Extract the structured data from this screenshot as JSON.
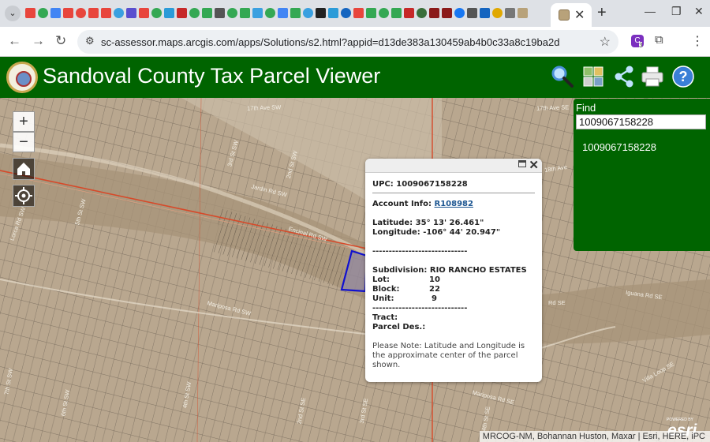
{
  "browser": {
    "url": "sc-assessor.maps.arcgis.com/apps/Solutions/s2.html?appid=d13de383a130459ab4b0c33a8c19ba2d",
    "extension_count": "3",
    "tab_icon_colors": [
      "#e8453c",
      "#34a853",
      "#4285f4",
      "#e8453c",
      "#e8453c",
      "#e8453c",
      "#e8453c",
      "#3aa0e0",
      "#5a4fcf",
      "#e8453c",
      "#34a853",
      "#2b9bd8",
      "#c62828",
      "#34a853",
      "#34a853",
      "#555555",
      "#34a853",
      "#34a853",
      "#3aa0e0",
      "#34a853",
      "#4285f4",
      "#34a853",
      "#3aa0e0",
      "#222222",
      "#2b9bd8",
      "#1565c0",
      "#e8453c",
      "#34a853",
      "#34a853",
      "#34a853",
      "#c62828",
      "#3a6e3a",
      "#8b1a1a",
      "#8b1a1a",
      "#1877f2",
      "#555555",
      "#1565c0",
      "#e0a800",
      "#777777",
      "#b8a27a"
    ]
  },
  "app": {
    "title": "Sandoval County Tax Parcel Viewer",
    "header_icons": [
      "search-icon",
      "basemap-gallery-icon",
      "share-icon",
      "print-icon",
      "help-icon"
    ]
  },
  "map": {
    "zoom_in": "+",
    "zoom_out": "−",
    "attribution": "MRCOG-NM, Bohannan Huston, Maxar | Esri, HERE, iPC",
    "powered_by": "POWERED BY",
    "esri": "esri",
    "streets": [
      {
        "name": "17th Ave SW"
      },
      {
        "name": "17th Ave SE"
      },
      {
        "name": "18th Ave"
      },
      {
        "name": "Jardin Rd SW"
      },
      {
        "name": "Encinal Rd SW"
      },
      {
        "name": "Mariposa Rd SW"
      },
      {
        "name": "Iguana Rd SE"
      },
      {
        "name": "Rd SE"
      },
      {
        "name": "Villa Loop SE"
      },
      {
        "name": "Mariposa Rd SE"
      },
      {
        "name": "3rd St SW"
      },
      {
        "name": "2nd St SW"
      },
      {
        "name": "5th St SW"
      },
      {
        "name": "7th St SW"
      },
      {
        "name": "6th St SW"
      },
      {
        "name": "4th St SW"
      },
      {
        "name": "Lorca Rd SW"
      },
      {
        "name": "2nd St SE"
      },
      {
        "name": "3rd St SE"
      },
      {
        "name": "4th St SE"
      }
    ]
  },
  "popup": {
    "upc_label": "UPC:",
    "upc": "1009067158228",
    "account_label": "Account Info:",
    "account": "R108982",
    "latitude_label": "Latitude:",
    "latitude": "35° 13' 26.461\"",
    "longitude_label": "Longitude:",
    "longitude": "-106° 44' 20.947\"",
    "divider": "-----------------------------",
    "subdivision_label": "Subdivision:",
    "subdivision": "RIO RANCHO ESTATES",
    "lot_label": "Lot:",
    "lot": "10",
    "block_label": "Block:",
    "block": "22",
    "unit_label": "Unit:",
    "unit": "9",
    "tract_label": "Tract:",
    "parcel_des_label": "Parcel Des.:",
    "note": "Please Note: Latitude and Longitude is the approximate center of the parcel shown."
  },
  "find": {
    "label": "Find",
    "value": "1009067158228",
    "result": "1009067158228"
  }
}
